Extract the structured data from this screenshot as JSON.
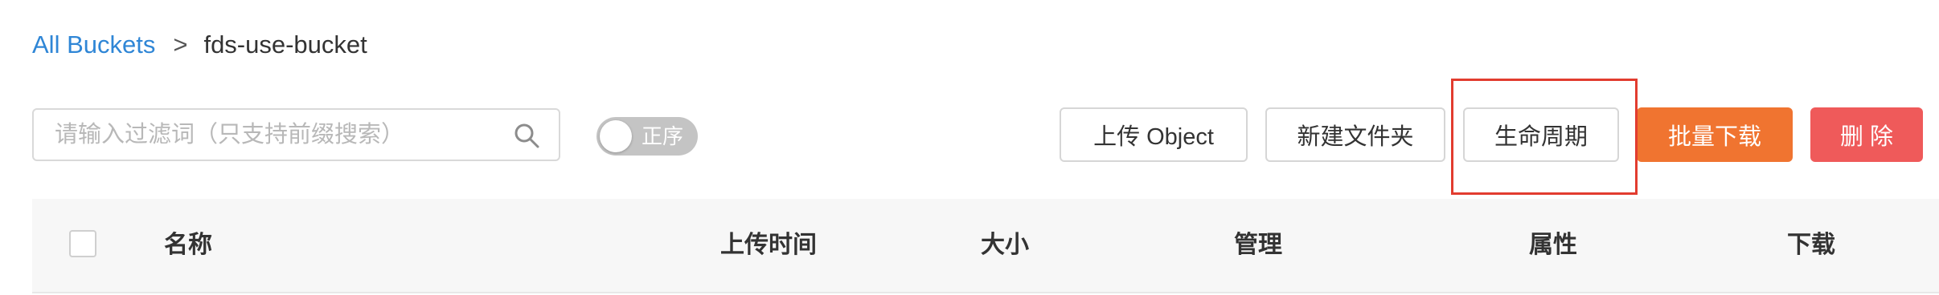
{
  "breadcrumb": {
    "root_label": "All Buckets",
    "separator": ">",
    "current": "fds-use-bucket"
  },
  "search": {
    "placeholder": "请输入过滤词（只支持前缀搜索）",
    "value": ""
  },
  "sort_toggle": {
    "label": "正序",
    "on": false
  },
  "toolbar": {
    "upload_label": "上传 Object",
    "new_folder_label": "新建文件夹",
    "lifecycle_label": "生命周期",
    "batch_download_label": "批量下载",
    "delete_label": "删 除"
  },
  "table": {
    "columns": [
      "名称",
      "上传时间",
      "大小",
      "管理",
      "属性",
      "下载"
    ]
  },
  "colors": {
    "link": "#2f86d6",
    "batch_download": "#f07430",
    "delete": "#ef5a5a",
    "highlight": "#e23c2f"
  },
  "icons": {
    "search": "search-icon"
  }
}
